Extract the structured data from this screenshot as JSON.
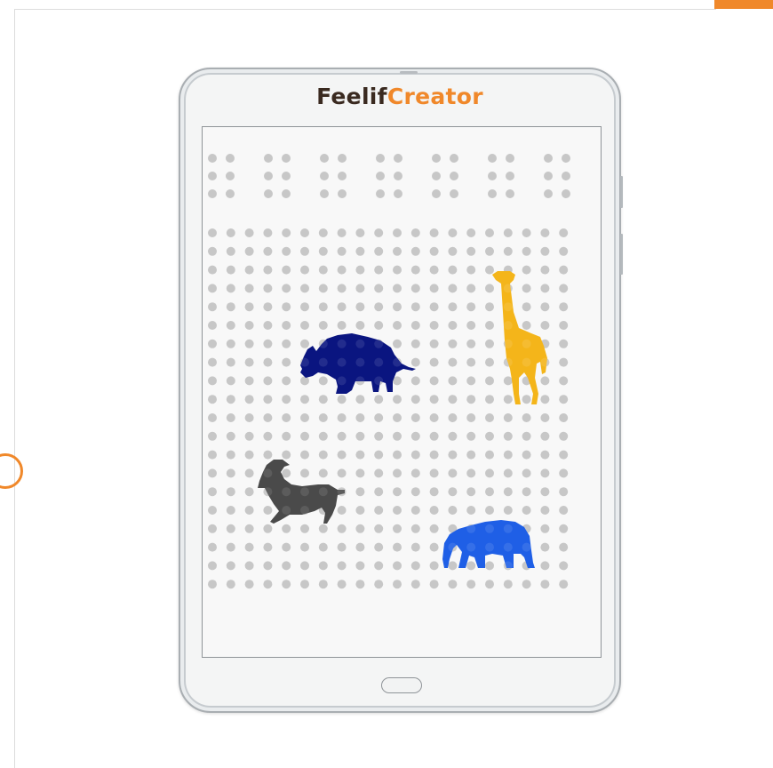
{
  "brand": {
    "part1": "Feelif",
    "part2": "Creator",
    "part1_color": "#3a2a20",
    "part2_color": "#f0882a"
  },
  "screen": {
    "braille_header_cells": 7,
    "dot_rows": 20,
    "dot_columns": 20,
    "dot_color": "#c7c7c7"
  },
  "shapes": [
    {
      "name": "rhino",
      "color": "#0a1580"
    },
    {
      "name": "giraffe",
      "color": "#f4b51a"
    },
    {
      "name": "goat",
      "color": "#4a4a4a"
    },
    {
      "name": "elephant",
      "color": "#1f5fe6"
    }
  ],
  "icons": [
    "home-button-icon",
    "side-ring-icon"
  ]
}
